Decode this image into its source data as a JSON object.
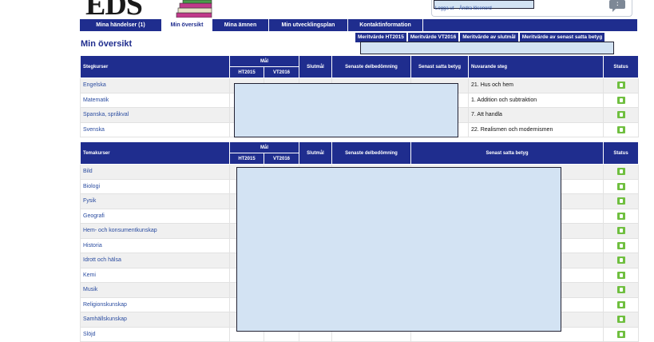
{
  "logo": {
    "text": "EDS"
  },
  "login": {
    "links": [
      "Logga ut",
      "Ändra lösenord"
    ]
  },
  "nav": {
    "tabs": [
      {
        "label": "Mina händelser (1)"
      },
      {
        "label": "Min översikt"
      },
      {
        "label": "Mina ämnen"
      },
      {
        "label": "Min utvecklingsplan"
      },
      {
        "label": "Kontaktinformation"
      }
    ]
  },
  "sub_tabs": [
    "Meritvärde HT2015",
    "Meritvärde VT2016",
    "Meritvärde av slutmål",
    "Meritvärde av senast satta betyg"
  ],
  "page_title": "Min översikt",
  "steg": {
    "headers": {
      "kurs": "Stegkurser",
      "mal": "Mål",
      "ht": "HT2015",
      "vt": "VT2016",
      "slutmal": "Slutmål",
      "delbedomning": "Senaste delbedömning",
      "betyg": "Senast satta betyg",
      "nuvarande": "Nuvarande steg",
      "status": "Status"
    },
    "rows": [
      {
        "course": "Engelska",
        "step": "21. Hus och hem"
      },
      {
        "course": "Matematik",
        "step": "1. Addition och subtraktion"
      },
      {
        "course": "Spanska, språkval",
        "step": "7. Att handla"
      },
      {
        "course": "Svenska",
        "step": "22. Realismen och modernismen"
      }
    ]
  },
  "tema": {
    "headers": {
      "kurs": "Temakurser",
      "mal": "Mål",
      "ht": "HT2015",
      "vt": "VT2016",
      "slutmal": "Slutmål",
      "delbedomning": "Senaste delbedömning",
      "betyg": "Senast satta betyg",
      "status": "Status"
    },
    "rows": [
      {
        "course": "Bild"
      },
      {
        "course": "Biologi"
      },
      {
        "course": "Fysik"
      },
      {
        "course": "Geografi"
      },
      {
        "course": "Hem- och konsumentkunskap"
      },
      {
        "course": "Historia"
      },
      {
        "course": "Idrott och hälsa"
      },
      {
        "course": "Kemi"
      },
      {
        "course": "Musik"
      },
      {
        "course": "Religionskunskap"
      },
      {
        "course": "Samhällskunskap"
      },
      {
        "course": "Slöjd"
      }
    ]
  },
  "colors": {
    "navy": "#1f2d8e",
    "link": "#2a4ca0",
    "thumb": "#6fbf3f",
    "redaction": "#d3e3f3"
  }
}
